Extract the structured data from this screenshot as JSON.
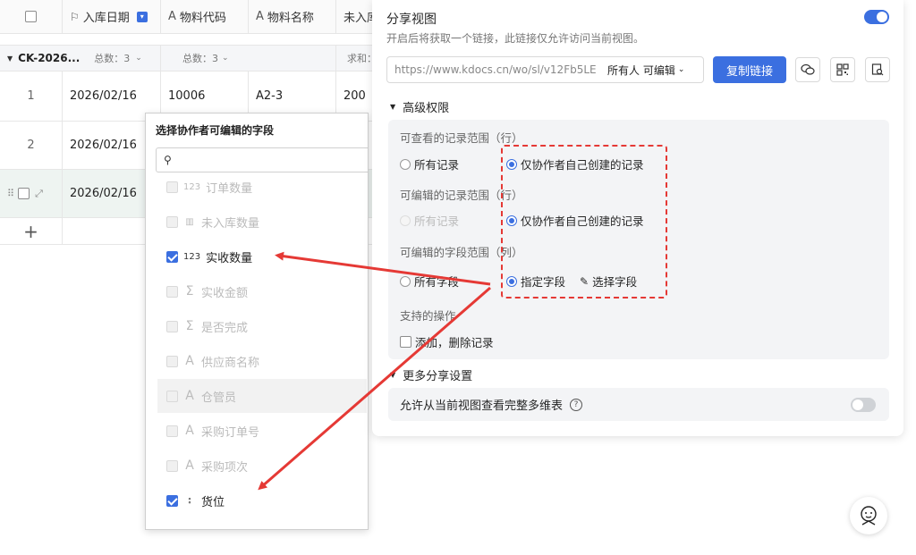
{
  "table": {
    "columns": [
      {
        "icon": "flag-icon",
        "label": "入库日期"
      },
      {
        "icon": "text-icon",
        "label": "物料代码"
      },
      {
        "icon": "text-icon",
        "label": "物料名称"
      },
      {
        "icon": "",
        "label": "未入库"
      }
    ],
    "group": {
      "name": "CK-2026...",
      "count1": "总数：3",
      "count2": "总数：3",
      "sum": "求和："
    },
    "rows": [
      {
        "index": "1",
        "date": "2026/02/16",
        "code": "10006",
        "name": "A2-3",
        "qty": "200"
      },
      {
        "index": "2",
        "date": "2026/02/16"
      },
      {
        "index": "",
        "date": "2026/02/16"
      }
    ],
    "add_row": "+"
  },
  "field_picker": {
    "title": "选择协作者可编辑的字段",
    "search_placeholder": "",
    "items": [
      {
        "icon": "123",
        "label": "订单数量",
        "checked": false,
        "enabled": false
      },
      {
        "icon": "bar",
        "label": "未入库数量",
        "checked": false,
        "enabled": false
      },
      {
        "icon": "123",
        "label": "实收数量",
        "checked": true,
        "enabled": true
      },
      {
        "icon": "Σ",
        "label": "实收金额",
        "checked": false,
        "enabled": false
      },
      {
        "icon": "Σ",
        "label": "是否完成",
        "checked": false,
        "enabled": false
      },
      {
        "icon": "A",
        "label": "供应商名称",
        "checked": false,
        "enabled": false
      },
      {
        "icon": "A",
        "label": "仓管员",
        "checked": false,
        "enabled": false
      },
      {
        "icon": "A",
        "label": "采购订单号",
        "checked": false,
        "enabled": false
      },
      {
        "icon": "A",
        "label": "采购项次",
        "checked": false,
        "enabled": false
      },
      {
        "icon": "scan",
        "label": "货位",
        "checked": true,
        "enabled": true
      }
    ]
  },
  "share": {
    "title": "分享视图",
    "description": "开启后将获取一个链接，此链接仅允许访问当前视图。",
    "toggle_on": true,
    "link": "https://www.kdocs.cn/wo/sl/v12Fb5LE",
    "permission": "所有人 可编辑",
    "copy_button": "复制链接",
    "advanced_title": "高级权限",
    "view_range_label": "可查看的记录范围（行）",
    "view_opt_all": "所有记录",
    "view_opt_own": "仅协作者自己创建的记录",
    "edit_range_label": "可编辑的记录范围（行）",
    "edit_opt_all": "所有记录",
    "edit_opt_own": "仅协作者自己创建的记录",
    "field_range_label": "可编辑的字段范围（列）",
    "field_opt_all": "所有字段",
    "field_opt_specific": "指定字段",
    "select_fields": "选择字段",
    "ops_label": "支持的操作",
    "ops_add_delete": "添加，删除记录",
    "more_title": "更多分享设置",
    "allow_full_label": "允许从当前视图查看完整多维表",
    "allow_full_on": false
  },
  "colors": {
    "accent": "#3b6fe0",
    "annotation": "#e53935"
  }
}
